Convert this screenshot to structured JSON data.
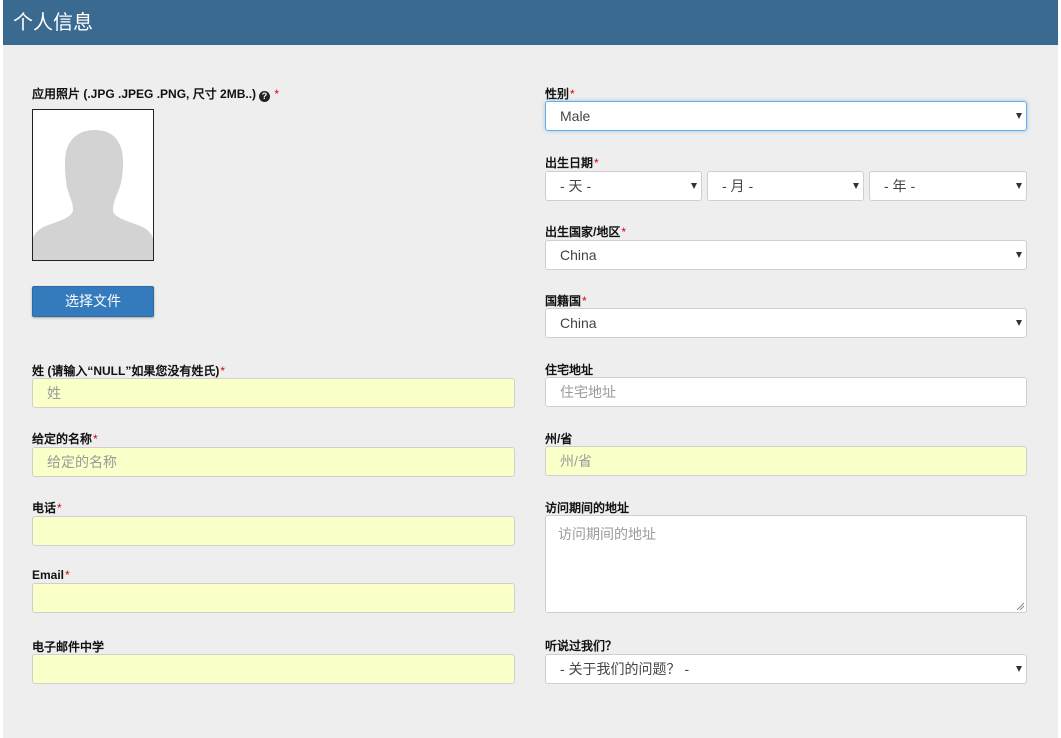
{
  "header": {
    "title": "个人信息"
  },
  "left": {
    "photo_label": "应用照片 (.JPG .JPEG .PNG, 尺寸 2MB..)",
    "photo_help_icon": "?",
    "photo_required": "*",
    "upload_button": "选择文件",
    "surname": {
      "label": "姓 (请输入“NULL”如果您没有姓氏)",
      "required": "*",
      "placeholder": "姓"
    },
    "given_name": {
      "label": "给定的名称",
      "required": "*",
      "placeholder": "给定的名称"
    },
    "phone": {
      "label": "电话",
      "required": "*",
      "value": ""
    },
    "email": {
      "label": "Email",
      "required": "*",
      "value": ""
    },
    "email_school": {
      "label": "电子邮件中学",
      "value": ""
    }
  },
  "right": {
    "gender": {
      "label": "性别",
      "required": "*",
      "value": "Male"
    },
    "birth_date": {
      "label": "出生日期",
      "required": "*",
      "day": "- 天 -",
      "month": "- 月 -",
      "year": "- 年 -"
    },
    "birth_country": {
      "label": "出生国家/地区",
      "required": "*",
      "value": "China"
    },
    "nationality": {
      "label": "国籍国",
      "required": "*",
      "value": "China"
    },
    "home_address": {
      "label": "住宅地址",
      "placeholder": "住宅地址"
    },
    "state": {
      "label": "州/省",
      "placeholder": "州/省"
    },
    "visit_address": {
      "label": "访问期间的地址",
      "placeholder": "访问期间的地址"
    },
    "heard_about": {
      "label": "听说过我们？",
      "value": "- 关于我们的问题？ -"
    }
  },
  "colors": {
    "header": "#3b6a90",
    "panel": "#eeeeee",
    "required": "#d9000d",
    "button": "#347bbd",
    "autofill": "#fbffc8"
  }
}
